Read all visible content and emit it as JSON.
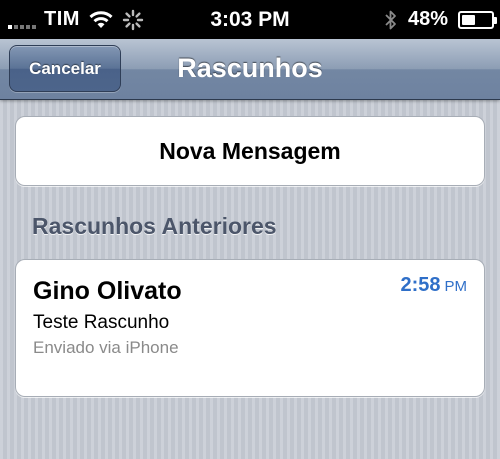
{
  "status_bar": {
    "carrier": "TIM",
    "time": "3:03 PM",
    "battery_percent": "48%",
    "battery_level": 0.48,
    "icons": [
      "signal-icon",
      "wifi-icon",
      "activity-spinner-icon",
      "bluetooth-icon",
      "battery-icon"
    ]
  },
  "nav": {
    "title": "Rascunhos",
    "cancel_label": "Cancelar"
  },
  "new_message": {
    "label": "Nova Mensagem"
  },
  "drafts": {
    "section_title": "Rascunhos Anteriores",
    "items": [
      {
        "sender": "Gino Olivato",
        "time": "2:58",
        "ampm": "PM",
        "subject": "Teste Rascunho",
        "preview": "Enviado via iPhone"
      }
    ]
  },
  "colors": {
    "accent_time": "#2f6fc8",
    "nav_bar": "#7387a3",
    "background": "#c7ccd5"
  }
}
